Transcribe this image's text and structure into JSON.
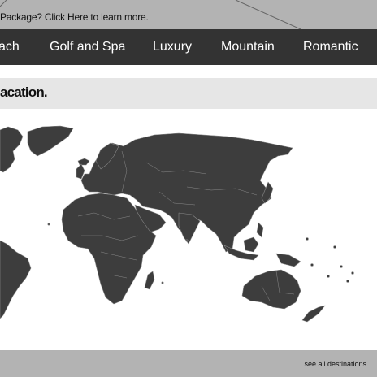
{
  "promo": {
    "text": "Package? Click Here to learn more."
  },
  "nav": {
    "items": [
      {
        "label": "ach"
      },
      {
        "label": "Golf and Spa"
      },
      {
        "label": "Luxury"
      },
      {
        "label": "Mountain"
      },
      {
        "label": "Romantic"
      }
    ]
  },
  "heading": {
    "text": "acation."
  },
  "map": {
    "land_color": "#3d3d3d",
    "border_color": "#8a8a8a"
  },
  "footer": {
    "see_all": "see all destinations"
  },
  "colors": {
    "nav_bg": "#333333",
    "top_bg": "#b3b3b3",
    "heading_bg": "#e6e6e6"
  }
}
